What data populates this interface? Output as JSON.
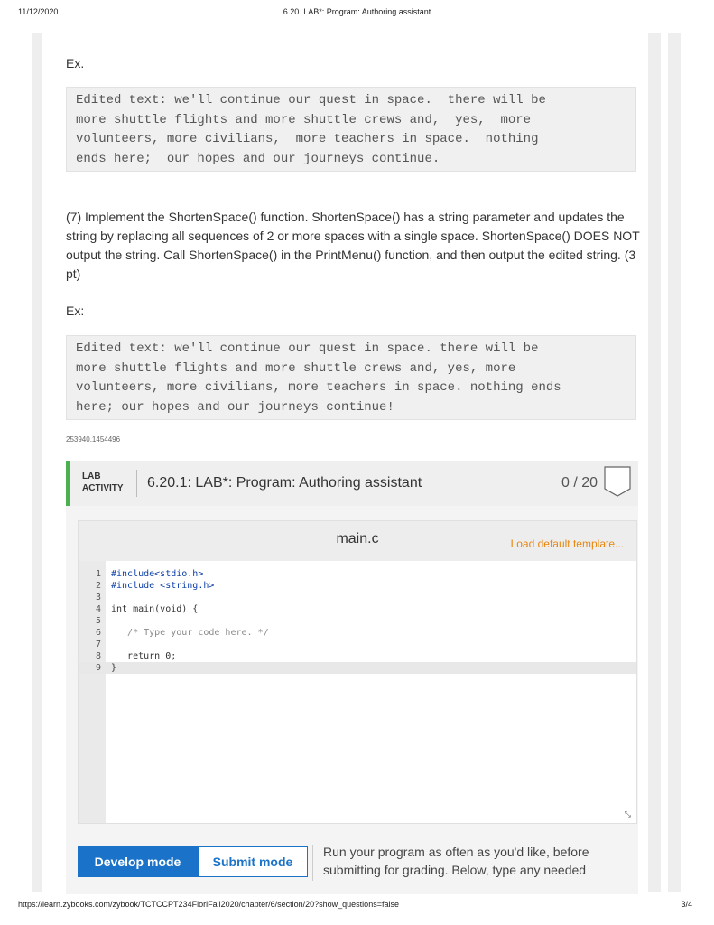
{
  "header": {
    "date": "11/12/2020",
    "title": "6.20. LAB*: Program: Authoring assistant"
  },
  "footer": {
    "url": "https://learn.zybooks.com/zybook/TCTCCPT234FioriFall2020/chapter/6/section/20?show_questions=false",
    "page": "3/4"
  },
  "example1": {
    "label": "Ex.",
    "code": "Edited text: we'll continue our quest in space.  there will be\nmore shuttle flights and more shuttle crews and,  yes,  more\nvolunteers, more civilians,  more teachers in space.  nothing\nends here;  our hopes and our journeys continue."
  },
  "step7": {
    "text": "(7) Implement the ShortenSpace() function. ShortenSpace() has a string parameter and updates the string by replacing all sequences of 2 or more spaces with a single space. ShortenSpace() DOES NOT output the string. Call ShortenSpace() in the PrintMenu() function, and then output the edited string. (3 pt)"
  },
  "example2": {
    "label": "Ex:",
    "code": "Edited text: we'll continue our quest in space. there will be\nmore shuttle flights and more shuttle crews and, yes, more\nvolunteers, more civilians, more teachers in space. nothing ends\nhere; our hopes and our journeys continue!"
  },
  "content_id": "253940.1454496",
  "lab": {
    "tag_line1": "LAB",
    "tag_line2": "ACTIVITY",
    "title": "6.20.1: LAB*: Program: Authoring assistant",
    "score": "0 / 20",
    "filename": "main.c",
    "load_template": "Load default template...",
    "code_lines": [
      {
        "n": "1",
        "text": "#include<stdio.h>"
      },
      {
        "n": "2",
        "text": "#include <string.h>"
      },
      {
        "n": "3",
        "text": ""
      },
      {
        "n": "4",
        "text": "int main(void) {"
      },
      {
        "n": "5",
        "text": ""
      },
      {
        "n": "6",
        "text": "   /* Type your code here. */"
      },
      {
        "n": "7",
        "text": ""
      },
      {
        "n": "8",
        "text": "   return 0;"
      },
      {
        "n": "9",
        "text": "}"
      }
    ],
    "develop_mode": "Develop mode",
    "submit_mode": "Submit mode",
    "run_text": "Run your program as often as you'd like, before submitting for grading. Below, type any needed"
  },
  "colors": {
    "accent": "#1a73c8",
    "lab_bar": "#4caf50",
    "load_link": "#e8860c"
  }
}
